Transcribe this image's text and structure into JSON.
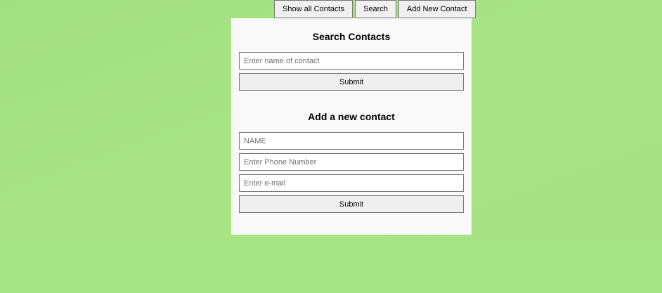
{
  "nav": {
    "show_all_label": "Show all Contacts",
    "search_label": "Search",
    "add_new_label": "Add New Contact"
  },
  "search_section": {
    "title": "Search Contacts",
    "name_placeholder": "Enter name of contact",
    "name_value": "",
    "submit_label": "Submit"
  },
  "add_section": {
    "title": "Add a new contact",
    "name_placeholder": "NAME",
    "name_value": "",
    "phone_placeholder": "Enter Phone Number",
    "phone_value": "",
    "email_placeholder": "Enter e-mail",
    "email_value": "",
    "submit_label": "Submit"
  },
  "colors": {
    "background": "#a6e384",
    "panel": "#f9f9f9",
    "button": "#efefef",
    "border": "#767676"
  }
}
